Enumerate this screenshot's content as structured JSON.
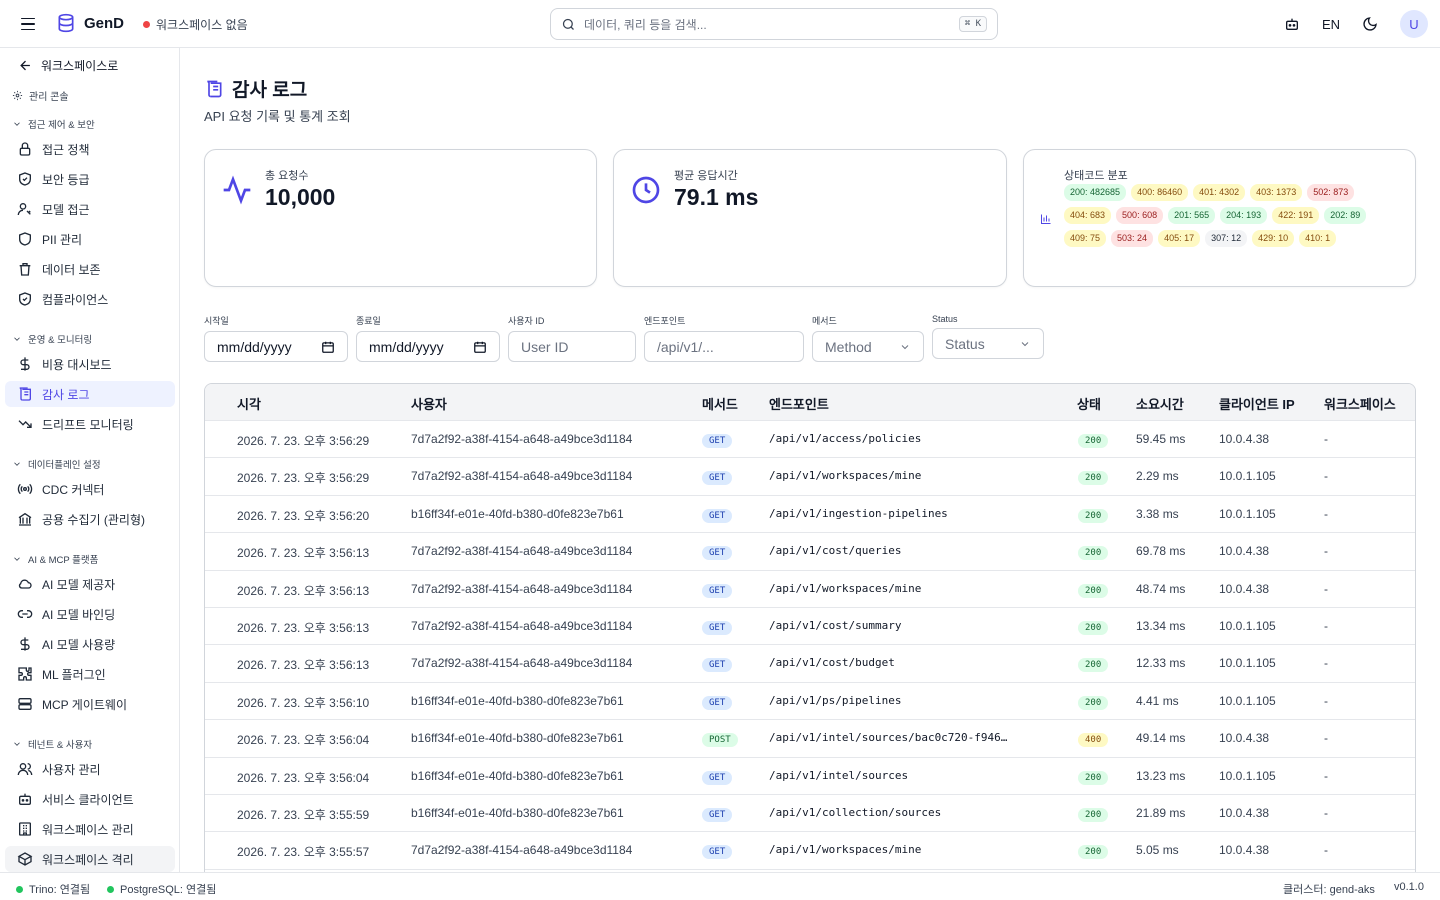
{
  "app": {
    "name": "GenD",
    "workspace_status": "워크스페이스 없음",
    "search_placeholder": "데이터, 쿼리 등을 검색...",
    "search_shortcut": "⌘ K",
    "lang": "EN",
    "avatar_initial": "U"
  },
  "sidebar": {
    "back_label": "워크스페이스로",
    "console_label": "관리 콘솔",
    "groups": [
      {
        "label": "접근 제어 & 보안",
        "items": [
          "접근 정책",
          "보안 등급",
          "모델 접근",
          "PII 관리",
          "데이터 보존",
          "컴플라이언스"
        ]
      },
      {
        "label": "운영 & 모니터링",
        "items": [
          "비용 대시보드",
          "감사 로그",
          "드리프트 모니터링"
        ]
      },
      {
        "label": "데이터플레인 설정",
        "items": [
          "CDC 커넥터",
          "공용 수집기 (관리형)"
        ]
      },
      {
        "label": "AI & MCP 플랫폼",
        "items": [
          "AI 모델 제공자",
          "AI 모델 바인딩",
          "AI 모델 사용량",
          "ML 플러그인",
          "MCP 게이트웨이"
        ]
      },
      {
        "label": "테넌트 & 사용자",
        "items": [
          "사용자 관리",
          "서비스 클라이언트",
          "워크스페이스 관리",
          "워크스페이스 격리"
        ]
      }
    ],
    "active_item": "감사 로그"
  },
  "page": {
    "title": "감사 로그",
    "subtitle": "API 요청 기록 및 통계 조회"
  },
  "stats": {
    "total_label": "총 요청수",
    "total_value": "10,000",
    "avg_label": "평균 응답시간",
    "avg_value": "79.1 ms",
    "codes_label": "상태코드 분포",
    "codes": [
      {
        "text": "200: 482685",
        "tone": "green"
      },
      {
        "text": "400: 86460",
        "tone": "yellow"
      },
      {
        "text": "401: 4302",
        "tone": "yellow"
      },
      {
        "text": "403: 1373",
        "tone": "yellow"
      },
      {
        "text": "502: 873",
        "tone": "red"
      },
      {
        "text": "404: 683",
        "tone": "yellow"
      },
      {
        "text": "500: 608",
        "tone": "red"
      },
      {
        "text": "201: 565",
        "tone": "green"
      },
      {
        "text": "204: 193",
        "tone": "green"
      },
      {
        "text": "422: 191",
        "tone": "yellow"
      },
      {
        "text": "202: 89",
        "tone": "green"
      },
      {
        "text": "409: 75",
        "tone": "yellow"
      },
      {
        "text": "503: 24",
        "tone": "red"
      },
      {
        "text": "405: 17",
        "tone": "yellow"
      },
      {
        "text": "307: 12",
        "tone": "gray"
      },
      {
        "text": "429: 10",
        "tone": "yellow"
      },
      {
        "text": "410: 1",
        "tone": "yellow"
      }
    ]
  },
  "filters": {
    "start_label": "시작일",
    "start_value": "mm/dd/yyyy",
    "end_label": "종료일",
    "end_value": "mm/dd/yyyy",
    "user_label": "사용자 ID",
    "user_placeholder": "User ID",
    "endpoint_label": "엔드포인트",
    "endpoint_placeholder": "/api/v1/...",
    "method_label": "메서드",
    "method_value": "Method",
    "status_label": "Status",
    "status_value": "Status"
  },
  "table": {
    "columns": [
      "시각",
      "사용자",
      "메서드",
      "엔드포인트",
      "상태",
      "소요시간",
      "클라이언트 IP",
      "워크스페이스"
    ],
    "rows": [
      {
        "time": "2026. 7. 23. 오후 3:56:29",
        "user": "7d7a2f92-a38f-4154-a648-a49bce3d1184",
        "method": "GET",
        "endpoint": "/api/v1/access/policies",
        "status": "200",
        "duration": "59.45 ms",
        "ip": "10.0.4.38",
        "ws": "-"
      },
      {
        "time": "2026. 7. 23. 오후 3:56:29",
        "user": "7d7a2f92-a38f-4154-a648-a49bce3d1184",
        "method": "GET",
        "endpoint": "/api/v1/workspaces/mine",
        "status": "200",
        "duration": "2.29 ms",
        "ip": "10.0.1.105",
        "ws": "-"
      },
      {
        "time": "2026. 7. 23. 오후 3:56:20",
        "user": "b16ff34f-e01e-40fd-b380-d0fe823e7b61",
        "method": "GET",
        "endpoint": "/api/v1/ingestion-pipelines",
        "status": "200",
        "duration": "3.38 ms",
        "ip": "10.0.1.105",
        "ws": "-"
      },
      {
        "time": "2026. 7. 23. 오후 3:56:13",
        "user": "7d7a2f92-a38f-4154-a648-a49bce3d1184",
        "method": "GET",
        "endpoint": "/api/v1/cost/queries",
        "status": "200",
        "duration": "69.78 ms",
        "ip": "10.0.4.38",
        "ws": "-"
      },
      {
        "time": "2026. 7. 23. 오후 3:56:13",
        "user": "7d7a2f92-a38f-4154-a648-a49bce3d1184",
        "method": "GET",
        "endpoint": "/api/v1/workspaces/mine",
        "status": "200",
        "duration": "48.74 ms",
        "ip": "10.0.4.38",
        "ws": "-"
      },
      {
        "time": "2026. 7. 23. 오후 3:56:13",
        "user": "7d7a2f92-a38f-4154-a648-a49bce3d1184",
        "method": "GET",
        "endpoint": "/api/v1/cost/summary",
        "status": "200",
        "duration": "13.34 ms",
        "ip": "10.0.1.105",
        "ws": "-"
      },
      {
        "time": "2026. 7. 23. 오후 3:56:13",
        "user": "7d7a2f92-a38f-4154-a648-a49bce3d1184",
        "method": "GET",
        "endpoint": "/api/v1/cost/budget",
        "status": "200",
        "duration": "12.33 ms",
        "ip": "10.0.1.105",
        "ws": "-"
      },
      {
        "time": "2026. 7. 23. 오후 3:56:10",
        "user": "b16ff34f-e01e-40fd-b380-d0fe823e7b61",
        "method": "GET",
        "endpoint": "/api/v1/ps/pipelines",
        "status": "200",
        "duration": "4.41 ms",
        "ip": "10.0.1.105",
        "ws": "-"
      },
      {
        "time": "2026. 7. 23. 오후 3:56:04",
        "user": "b16ff34f-e01e-40fd-b380-d0fe823e7b61",
        "method": "POST",
        "endpoint": "/api/v1/intel/sources/bac0c720-f946…",
        "status": "400",
        "duration": "49.14 ms",
        "ip": "10.0.4.38",
        "ws": "-"
      },
      {
        "time": "2026. 7. 23. 오후 3:56:04",
        "user": "b16ff34f-e01e-40fd-b380-d0fe823e7b61",
        "method": "GET",
        "endpoint": "/api/v1/intel/sources",
        "status": "200",
        "duration": "13.23 ms",
        "ip": "10.0.1.105",
        "ws": "-"
      },
      {
        "time": "2026. 7. 23. 오후 3:55:59",
        "user": "b16ff34f-e01e-40fd-b380-d0fe823e7b61",
        "method": "GET",
        "endpoint": "/api/v1/collection/sources",
        "status": "200",
        "duration": "21.89 ms",
        "ip": "10.0.4.38",
        "ws": "-"
      },
      {
        "time": "2026. 7. 23. 오후 3:55:57",
        "user": "7d7a2f92-a38f-4154-a648-a49bce3d1184",
        "method": "GET",
        "endpoint": "/api/v1/workspaces/mine",
        "status": "200",
        "duration": "5.05 ms",
        "ip": "10.0.4.38",
        "ws": "-"
      }
    ]
  },
  "footer": {
    "trino": "Trino: 연결됨",
    "postgres": "PostgreSQL: 연결됨",
    "cluster": "클러스터: gend-aks",
    "version": "v0.1.0"
  },
  "colors": {
    "accent": "#4f46e5",
    "connected": "#22c55e",
    "no_workspace": "#ef4444"
  }
}
